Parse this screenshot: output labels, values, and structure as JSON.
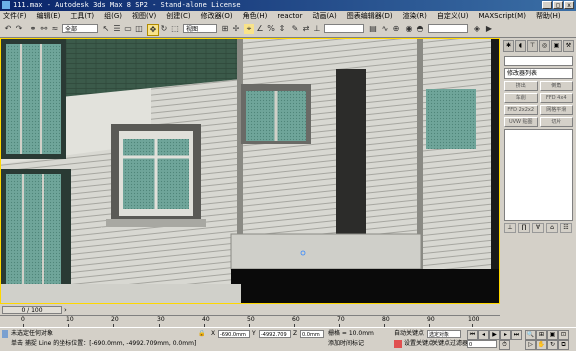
{
  "window": {
    "title": "111.max - Autodesk 3ds Max 8 SP2 - Stand-alone License",
    "min": "_",
    "max": "□",
    "close": "x"
  },
  "menu": [
    "文件(F)",
    "编辑(E)",
    "工具(T)",
    "组(G)",
    "视图(V)",
    "创建(C)",
    "修改器(O)",
    "角色(H)",
    "reactor",
    "动画(A)",
    "图表编辑器(D)",
    "渲染(R)",
    "自定义(U)",
    "MAXScript(M)",
    "帮助(H)"
  ],
  "toolbar": {
    "filter_value": "全部",
    "coord_value": "视图"
  },
  "command_panel": {
    "modifier_list": "修改器列表",
    "buttons": [
      "挤出",
      "倒角",
      "车削",
      "FFD 4x4",
      "FFD 2x2x2",
      "网格平滑",
      "UVW 贴图",
      "切片"
    ]
  },
  "timebar": {
    "frame": "0 / 100",
    "tick_labels": [
      "0",
      "10",
      "20",
      "30",
      "40",
      "50",
      "60",
      "70",
      "80",
      "90",
      "100"
    ]
  },
  "status": {
    "selection": "未选定任何对象",
    "prompt": "单击 捕捉 Line 的坐标位置：[-690.0mm, -4992.709mm, 0.0mm]",
    "x": "-690.0mm",
    "y": "-4992.709",
    "z": "0.0mm",
    "grid": "栅格 = 10.0mm",
    "auto_key": "自动关键点",
    "set_key": "设置关键点",
    "key_filter_value": "选定对象",
    "key_filters": "关键点过滤器",
    "add_time_tag": "添加时间标记",
    "frame_value": "0"
  }
}
